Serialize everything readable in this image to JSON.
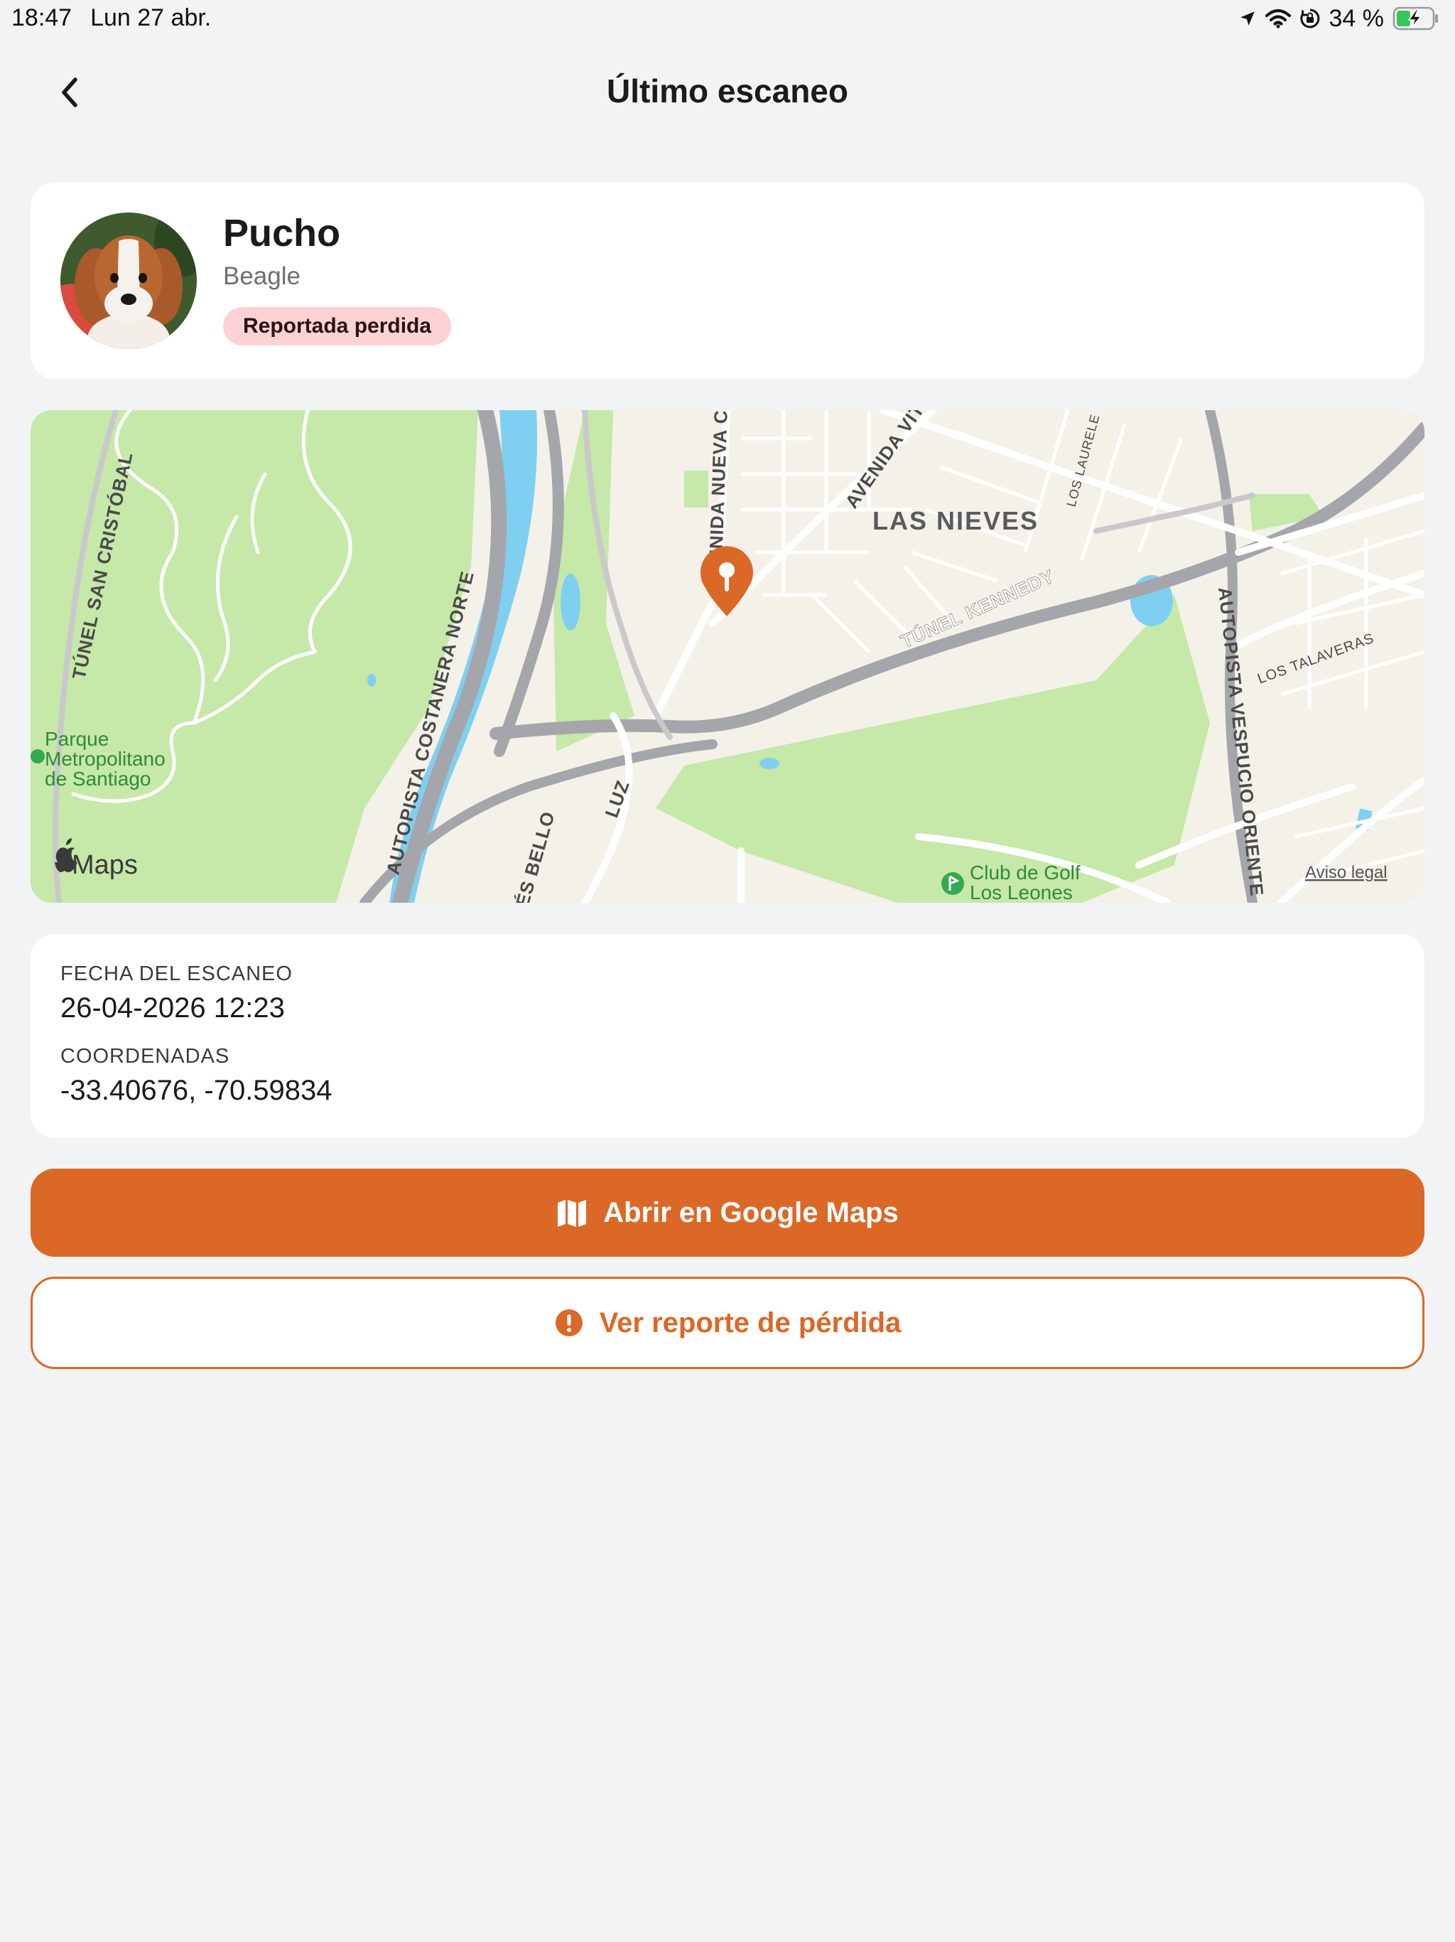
{
  "status_bar": {
    "time": "18:47",
    "date": "Lun 27 abr.",
    "battery_percent": "34 %",
    "icons": [
      "location-arrow-icon",
      "wifi-icon",
      "orientation-lock-icon",
      "battery-charging-icon"
    ]
  },
  "nav": {
    "back_icon": "chevron-left-icon",
    "title": "Último escaneo"
  },
  "pet": {
    "name": "Pucho",
    "breed": "Beagle",
    "status_badge": "Reportada perdida",
    "badge_color": "#fdd2d4"
  },
  "map": {
    "pin_color": "#dc6828",
    "labels": {
      "tunel_san_cristobal": "TÚNEL SAN CRISTÓBAL",
      "costanera": "AUTOPISTA COSTANERA NORTE",
      "avenida_nueva": "AVENIDA NUEVA CO",
      "avenida_vita": "AVENIDA VITA",
      "las_nieves": "LAS NIEVES",
      "los_laurele": "LOS LAURELE",
      "tunel_kennedy": "TÚNEL KENNEDY",
      "vespucio": "AUTOPISTA VESPUCIO ORIENTE",
      "los_talaveras": "LOS TALAVERAS",
      "parque_line1": "Parque",
      "parque_line2": "Metropolitano",
      "parque_line3": "de Santiago",
      "bello": "ÉS BELLO",
      "luz": "LUZ",
      "golf_line1": "Club de Golf",
      "golf_line2": "Los Leones",
      "maps_brand": "Maps",
      "legal": "Aviso legal"
    }
  },
  "scan": {
    "date_label": "FECHA DEL ESCANEO",
    "date_value": "26-04-2026 12:23",
    "coords_label": "COORDENADAS",
    "coords_value": "-33.40676, -70.59834"
  },
  "actions": {
    "google_maps_label": "Abrir en Google Maps",
    "google_maps_icon": "map-icon",
    "report_label": "Ver reporte de pérdida",
    "report_icon": "alert-circle-icon",
    "accent_color": "#dc6828"
  }
}
